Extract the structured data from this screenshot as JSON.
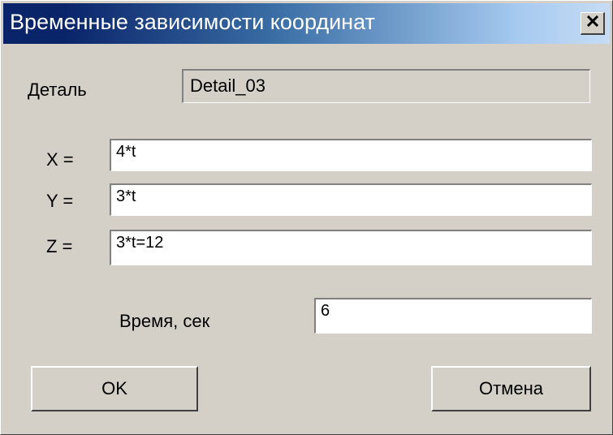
{
  "window": {
    "title": "Временные зависимости координат",
    "close_icon": "close-icon"
  },
  "detail": {
    "label": "Деталь",
    "value": "Detail_03"
  },
  "coords": {
    "x_label": "X =",
    "x_value": "4*t",
    "y_label": "Y =",
    "y_value": "3*t",
    "z_label": "Z =",
    "z_value": "3*t=12"
  },
  "time": {
    "label": "Время, сек",
    "value": "6"
  },
  "buttons": {
    "ok": "OK",
    "cancel": "Отмена"
  }
}
